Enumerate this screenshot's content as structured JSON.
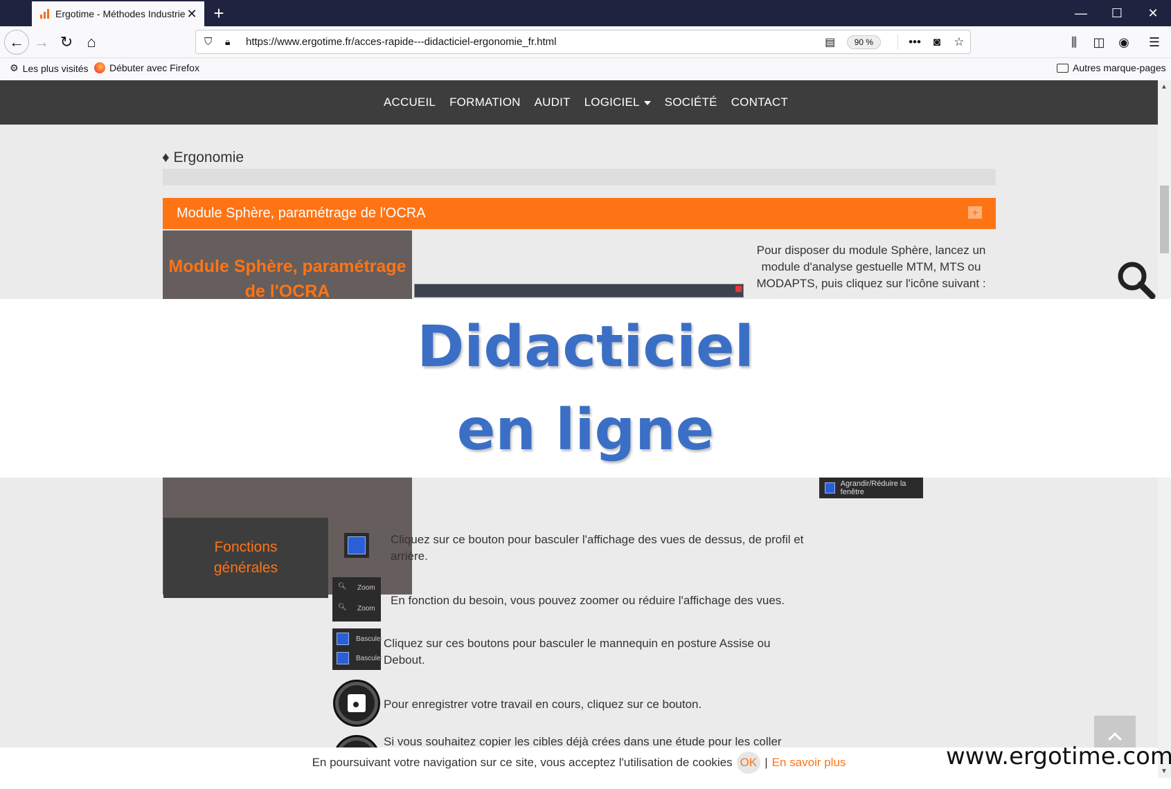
{
  "browser": {
    "tab_title": "Ergotime - Méthodes Industriel",
    "url": "https://www.ergotime.fr/acces-rapide---didacticiel-ergonomie_fr.html",
    "zoom": "90 %",
    "bookmarks": [
      "Les plus visités",
      "Débuter avec Firefox"
    ],
    "other_bookmarks": "Autres marque-pages"
  },
  "site_nav": {
    "items": [
      "ACCUEIL",
      "FORMATION",
      "AUDIT",
      "LOGICIEL",
      "SOCIÉTÉ",
      "CONTACT"
    ]
  },
  "breadcrumb": "♦ Ergonomie",
  "section": {
    "bar_title": "Module Sphère, paramétrage de l'OCRA",
    "block_title": "Module Sphère, paramétrage de l'OCRA",
    "intro": "Pour disposer du module Sphère, lancez un module d'analyse gestuelle MTM, MTS ou MODAPTS, puis cliquez sur l'icône suivant :",
    "screenshot_label": "Agrandir/Réduire la fenêtre",
    "button_label": "Agrandir/Réduire la fenêtre"
  },
  "functions": {
    "title_line1": "Fonctions",
    "title_line2": "générales",
    "items": [
      "Cliquez sur ce bouton pour basculer l'affichage des vues de dessus, de profil et arrière.",
      "En fonction du besoin, vous pouvez zoomer ou réduire l'affichage des vues.",
      "Cliquez sur ces boutons pour basculer le mannequin en posture Assise ou Debout.",
      "Pour enregistrer votre travail en cours, cliquez sur ce bouton.",
      "Si vous souhaitez copier les cibles déjà crées dans une étude pour les coller"
    ],
    "zoom_label": "Zoom",
    "basculer_label": "Basculer"
  },
  "cookie": {
    "text": "En poursuivant votre navigation sur ce site, vous acceptez l'utilisation de cookies",
    "ok": "OK",
    "sep": "|",
    "more": "En savoir plus"
  },
  "overlay": {
    "line1": "Didacticiel",
    "line2": "en ligne"
  },
  "watermark": "www.ergotime.com",
  "colors": {
    "accent": "#fe7415",
    "nav_bg": "#3d3d3d",
    "overlay_text": "#3b6fc6"
  }
}
